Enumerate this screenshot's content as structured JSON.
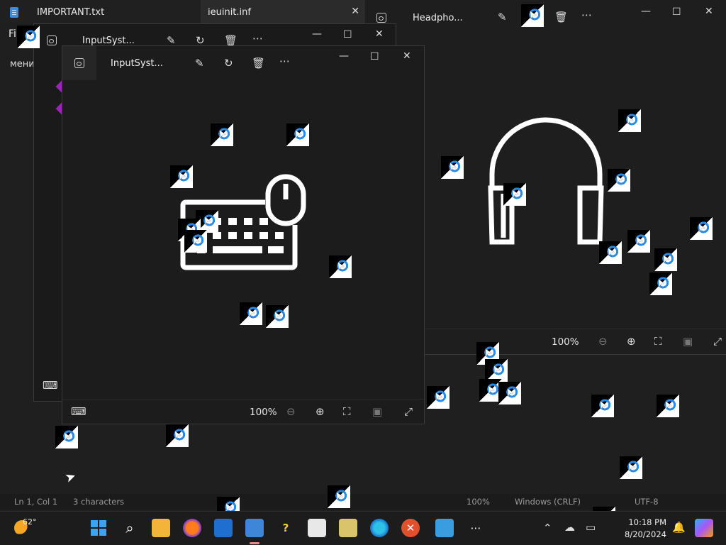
{
  "notepad": {
    "tab1": "IMPORTANT.txt",
    "tab2": "ieuinit.inf",
    "menu_file": "Fil",
    "text": "мени",
    "status": {
      "position": "Ln 1, Col 1",
      "chars": "3 characters",
      "zoom": "100%",
      "eol": "Windows (CRLF)",
      "encoding": "UTF-8"
    }
  },
  "headphones_window": {
    "title": "Headpho...",
    "zoom": "100%"
  },
  "input_back_window": {
    "title": "InputSyst..."
  },
  "input_front_window": {
    "title": "InputSyst...",
    "zoom": "100%"
  },
  "taskbar": {
    "weather_temp": "62°",
    "time": "10:18 PM",
    "date": "8/20/2024"
  },
  "colors": {
    "accent": "#2a8be6",
    "diamond": "#a020c0"
  }
}
